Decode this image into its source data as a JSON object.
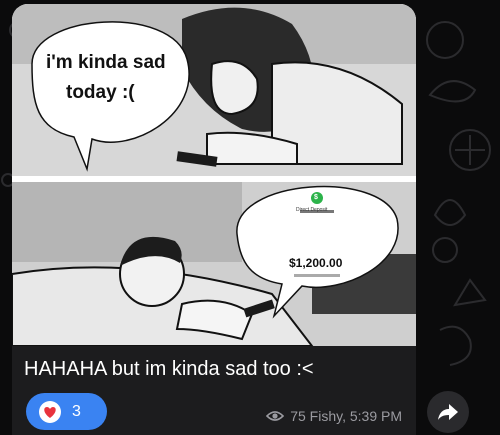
{
  "message": {
    "speech_top": [
      "i'm kinda sad",
      "today :("
    ],
    "speech_money": {
      "amount": "$1,200.00",
      "small_text": "Direct Deposit",
      "badge_symbol": "$"
    },
    "caption": "HAHAHA but im kinda sad too :<",
    "reaction": {
      "count": "3",
      "icon": "heart-icon"
    },
    "meta": {
      "views_icon": "eye-icon",
      "views_and_time": "75 Fishy, 5:39 PM"
    },
    "forward_icon": "forward-arrow-icon"
  },
  "colors": {
    "chat_background": "#0b0b0c",
    "bubble_background": "#1c1c1e",
    "reaction_pill": "#3a83f2",
    "meta_text": "#9b9ba1",
    "money_badge": "#2cb34a"
  }
}
